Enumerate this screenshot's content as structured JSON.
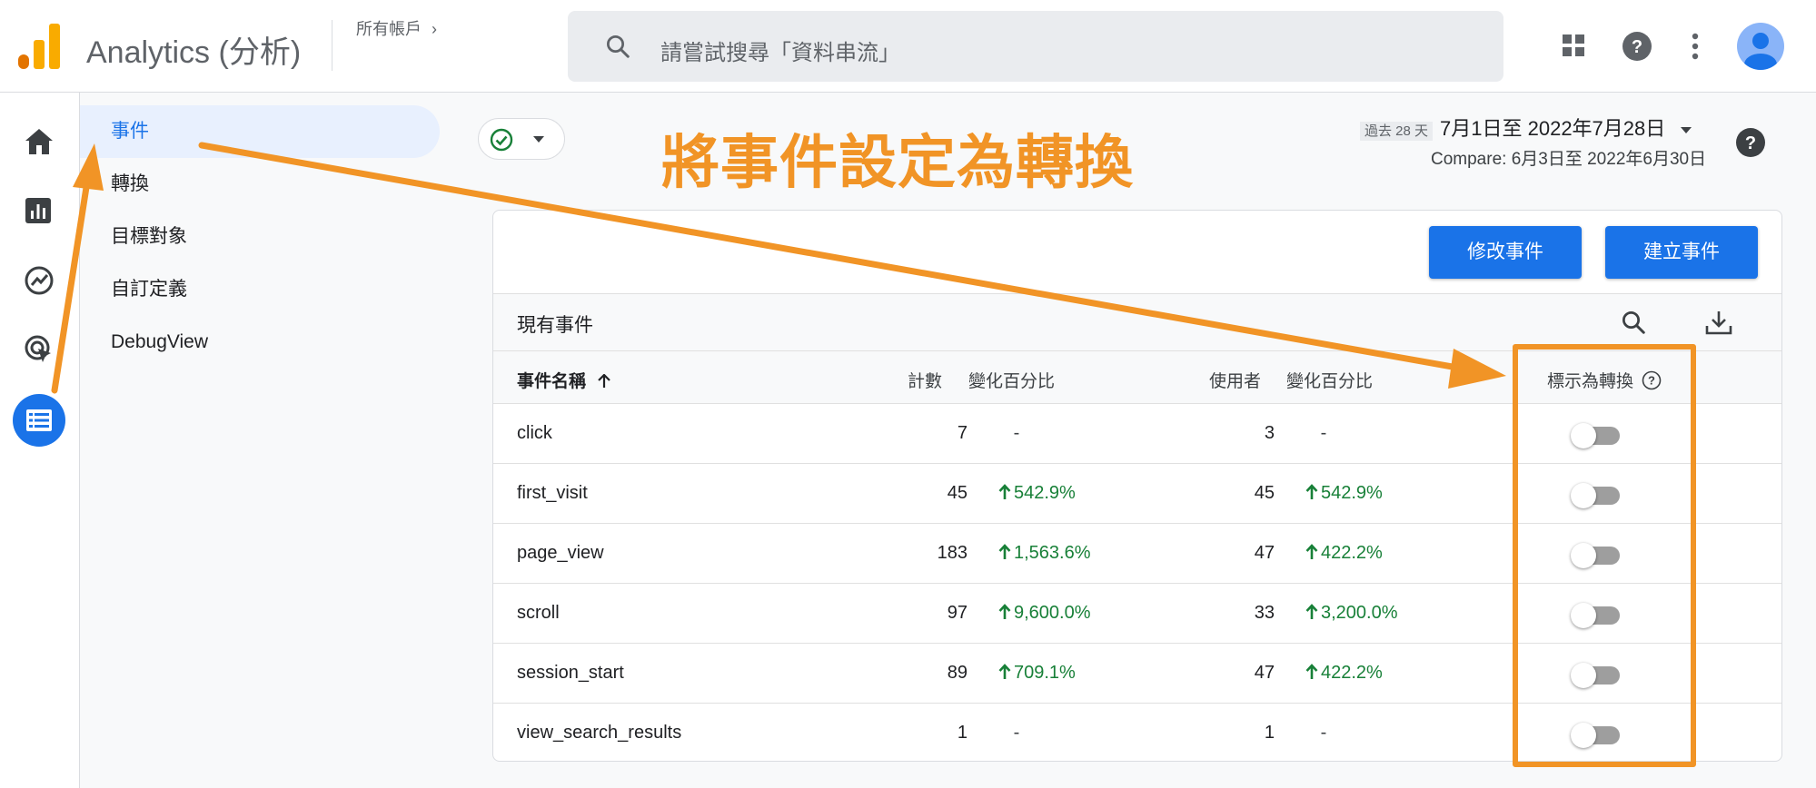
{
  "header": {
    "app_title": "Analytics (分析)",
    "account_label": "所有帳戶",
    "search_placeholder": "請嘗試搜尋「資料串流」",
    "icons": [
      "apps-grid-icon",
      "help-icon",
      "more-vert-icon",
      "account-avatar"
    ]
  },
  "rail": {
    "items": [
      "home-icon",
      "reports-icon",
      "explore-icon",
      "advertising-icon",
      "configure-icon"
    ],
    "active": "configure-icon"
  },
  "subnav": {
    "items": [
      {
        "label": "事件",
        "active": true
      },
      {
        "label": "轉換",
        "active": false
      },
      {
        "label": "目標對象",
        "active": false
      },
      {
        "label": "自訂定義",
        "active": false
      },
      {
        "label": "DebugView",
        "active": false
      }
    ]
  },
  "annotation": {
    "title": "將事件設定為轉換",
    "color": "#f19426"
  },
  "date": {
    "range_prefix": "過去 28 天",
    "range": "7月1日至 2022年7月28日",
    "compare": "Compare: 6月3日至 2022年6月30日"
  },
  "card": {
    "modify_button": "修改事件",
    "create_button": "建立事件",
    "title": "現有事件",
    "columns": {
      "event_name": "事件名稱",
      "count": "計數",
      "count_change": "變化百分比",
      "users": "使用者",
      "users_change": "變化百分比",
      "mark_conversion": "標示為轉換"
    },
    "rows": [
      {
        "name": "click",
        "count": "7",
        "count_change": "-",
        "users": "3",
        "users_change": "-",
        "conversion": false
      },
      {
        "name": "first_visit",
        "count": "45",
        "count_change": "542.9%",
        "users": "45",
        "users_change": "542.9%",
        "conversion": false
      },
      {
        "name": "page_view",
        "count": "183",
        "count_change": "1,563.6%",
        "users": "47",
        "users_change": "422.2%",
        "conversion": false
      },
      {
        "name": "scroll",
        "count": "97",
        "count_change": "9,600.0%",
        "users": "33",
        "users_change": "3,200.0%",
        "conversion": false
      },
      {
        "name": "session_start",
        "count": "89",
        "count_change": "709.1%",
        "users": "47",
        "users_change": "422.2%",
        "conversion": false
      },
      {
        "name": "view_search_results",
        "count": "1",
        "count_change": "-",
        "users": "1",
        "users_change": "-",
        "conversion": false
      }
    ]
  },
  "colors": {
    "primary": "#1a73e8",
    "positive": "#188038",
    "annotation": "#f19426"
  }
}
